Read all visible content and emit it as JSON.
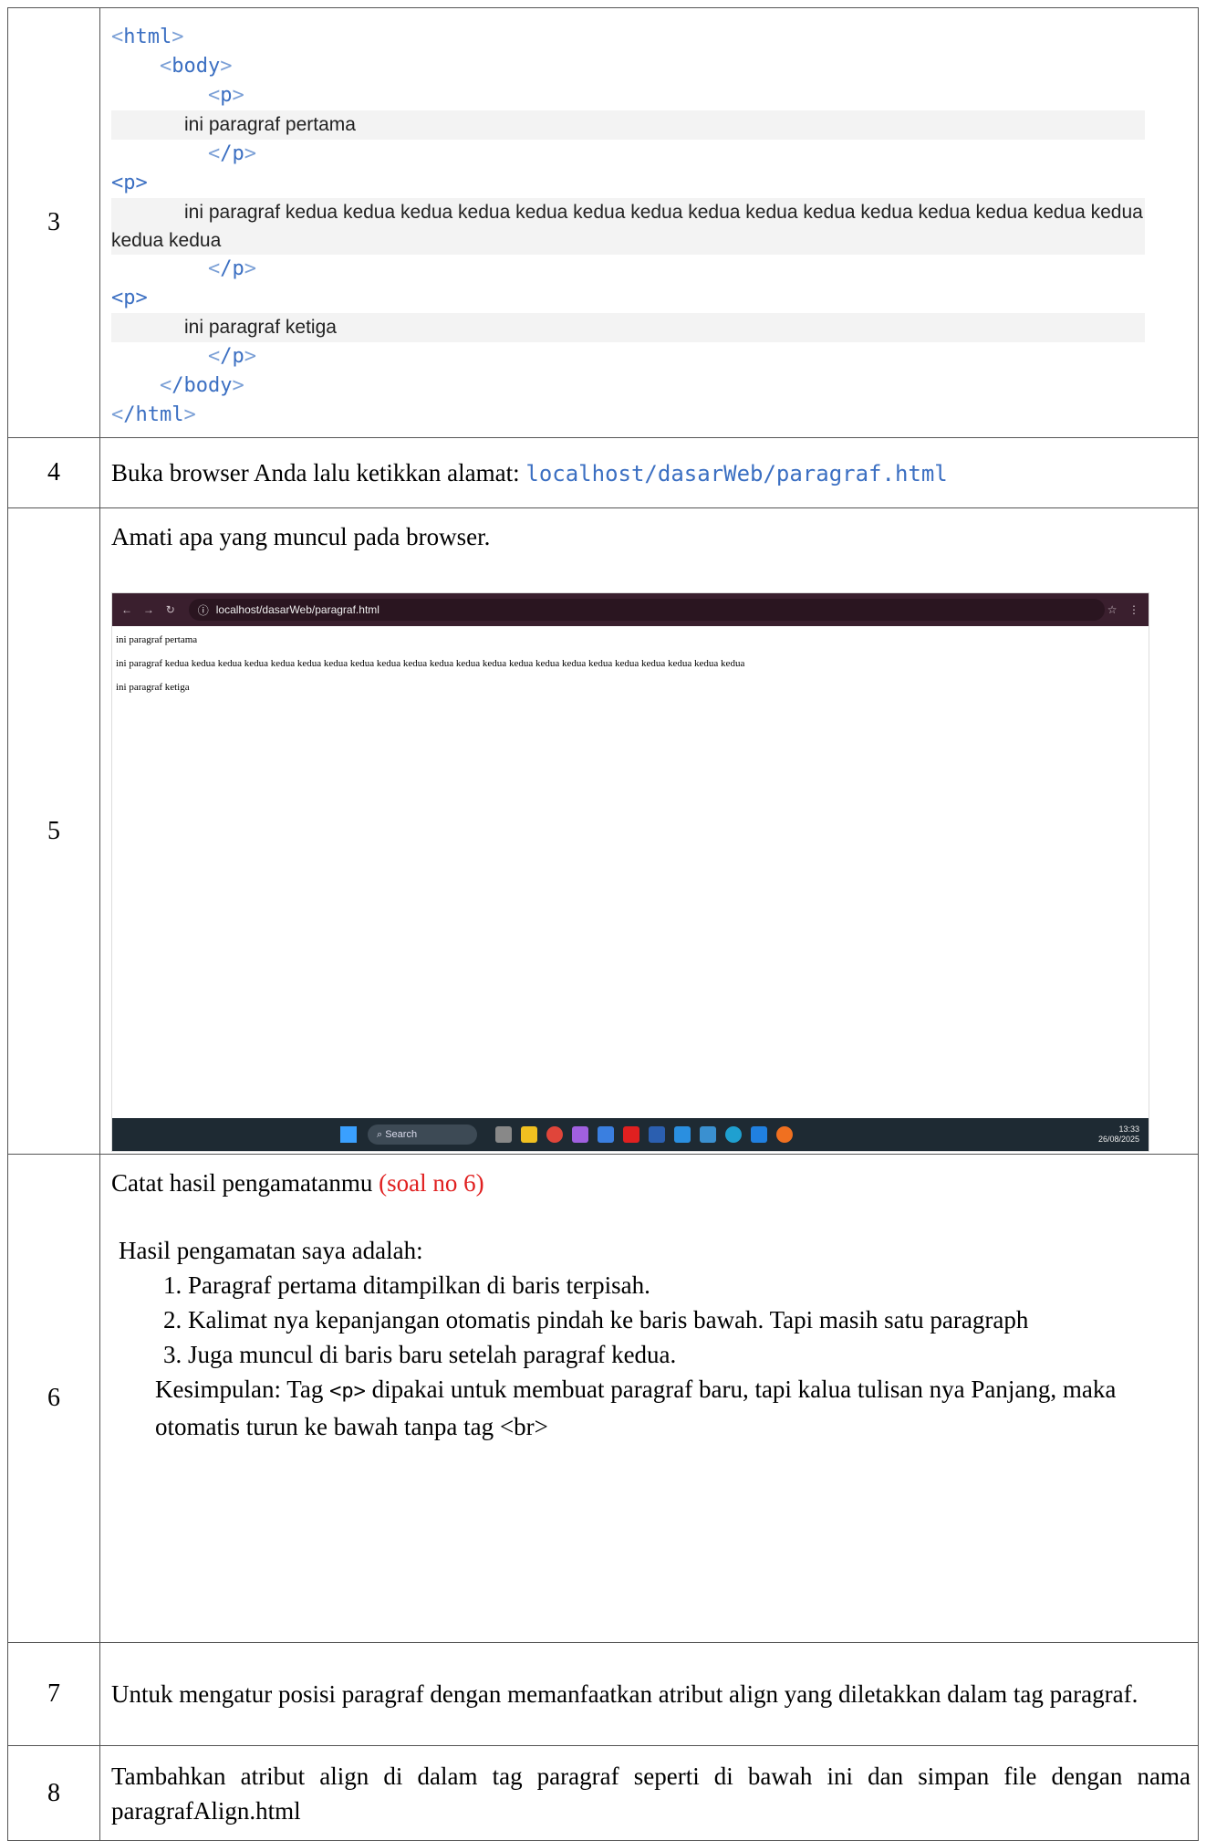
{
  "row3": {
    "num": "3",
    "code": {
      "html_open": "html",
      "body_open": "body",
      "p_tag": "p",
      "p1_text": "ini paragraf pertama",
      "p2_text": "ini paragraf kedua kedua kedua kedua kedua kedua kedua kedua kedua kedua kedua kedua kedua kedua kedua kedua kedua",
      "p3_text": "ini paragraf ketiga",
      "p_close": "/p",
      "body_close": "/body",
      "html_close": "/html"
    }
  },
  "row4": {
    "num": "4",
    "text": "Buka browser Anda lalu ketikkan alamat: ",
    "url": "localhost/dasarWeb/paragraf.html"
  },
  "row5": {
    "num": "5",
    "text": "Amati apa yang muncul pada browser.",
    "screenshot": {
      "url": "localhost/dasarWeb/paragraf.html",
      "p1": "ini paragraf pertama",
      "p2": "ini paragraf kedua kedua kedua kedua kedua kedua kedua kedua kedua kedua kedua kedua kedua kedua kedua kedua kedua kedua kedua kedua kedua kedua",
      "p3": "ini paragraf ketiga",
      "search": "Search",
      "time": "13:33",
      "date": "26/08/2025"
    }
  },
  "row6": {
    "num": "6",
    "title": "Catat hasil pengamatanmu ",
    "title_note": "(soal no 6)",
    "intro": "Hasil pengamatan saya adalah:",
    "items": [
      "Paragraf pertama ditampilkan di baris terpisah.",
      "Kalimat nya kepanjangan otomatis pindah ke baris bawah. Tapi masih satu paragraph",
      "Juga muncul di baris baru setelah paragraf kedua."
    ],
    "conclusion_a": "Kesimpulan: Tag ",
    "conclusion_tag": "<p>",
    "conclusion_b": " dipakai untuk membuat paragraf baru, tapi kalua tulisan nya Panjang, maka otomatis turun ke bawah tanpa tag <br>"
  },
  "row7": {
    "num": "7",
    "text": "Untuk mengatur posisi paragraf dengan memanfaatkan atribut align yang diletakkan dalam tag paragraf."
  },
  "row8": {
    "num": "8",
    "text": "Tambahkan atribut align di dalam tag paragraf seperti di bawah ini dan simpan file dengan nama paragrafAlign.html"
  }
}
